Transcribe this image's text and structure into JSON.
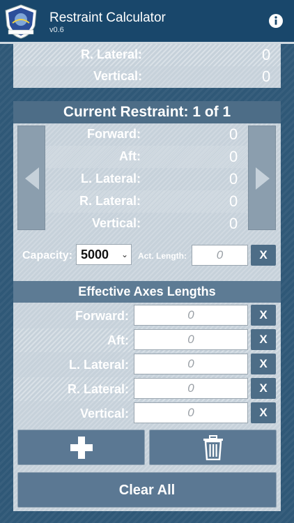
{
  "appbar": {
    "title": "Restraint Calculator",
    "version": "v0.6"
  },
  "summary": [
    {
      "label": "R. Lateral:",
      "value": "0"
    },
    {
      "label": "Vertical:",
      "value": "0"
    }
  ],
  "current": {
    "header": "Current Restraint: 1 of 1",
    "rows": [
      {
        "label": "Forward:",
        "value": "0"
      },
      {
        "label": "Aft:",
        "value": "0"
      },
      {
        "label": "L. Lateral:",
        "value": "0"
      },
      {
        "label": "R. Lateral:",
        "value": "0"
      },
      {
        "label": "Vertical:",
        "value": "0"
      }
    ],
    "capacity_label": "Capacity:",
    "capacity_value": "5000",
    "act_length_label": "Act. Length:",
    "act_length_placeholder": "0",
    "clear_label": "X"
  },
  "axes": {
    "header": "Effective Axes Lengths",
    "rows": [
      {
        "label": "Forward:",
        "placeholder": "0"
      },
      {
        "label": "Aft:",
        "placeholder": "0"
      },
      {
        "label": "L. Lateral:",
        "placeholder": "0"
      },
      {
        "label": "R. Lateral:",
        "placeholder": "0"
      },
      {
        "label": "Vertical:",
        "placeholder": "0"
      }
    ],
    "clear_label": "X"
  },
  "actions": {
    "clear_all": "Clear All"
  },
  "icons": [
    "command-logo-icon",
    "info-icon",
    "left-arrow-icon",
    "right-arrow-icon",
    "plus-icon",
    "trash-icon"
  ]
}
